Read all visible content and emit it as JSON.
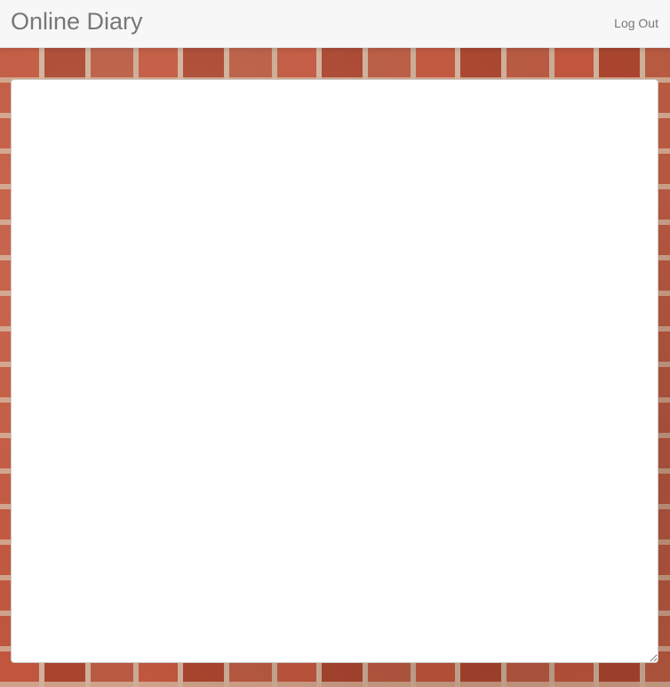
{
  "app": {
    "brand": "Online Diary"
  },
  "nav": {
    "logout_label": "Log Out"
  },
  "diary": {
    "value": "",
    "placeholder": ""
  },
  "colors": {
    "navbar_bg": "#f7f7f7",
    "nav_text": "#777777",
    "textarea_bg": "#ffffff"
  },
  "icons": {
    "resize_handle": "resize-grip-icon"
  }
}
